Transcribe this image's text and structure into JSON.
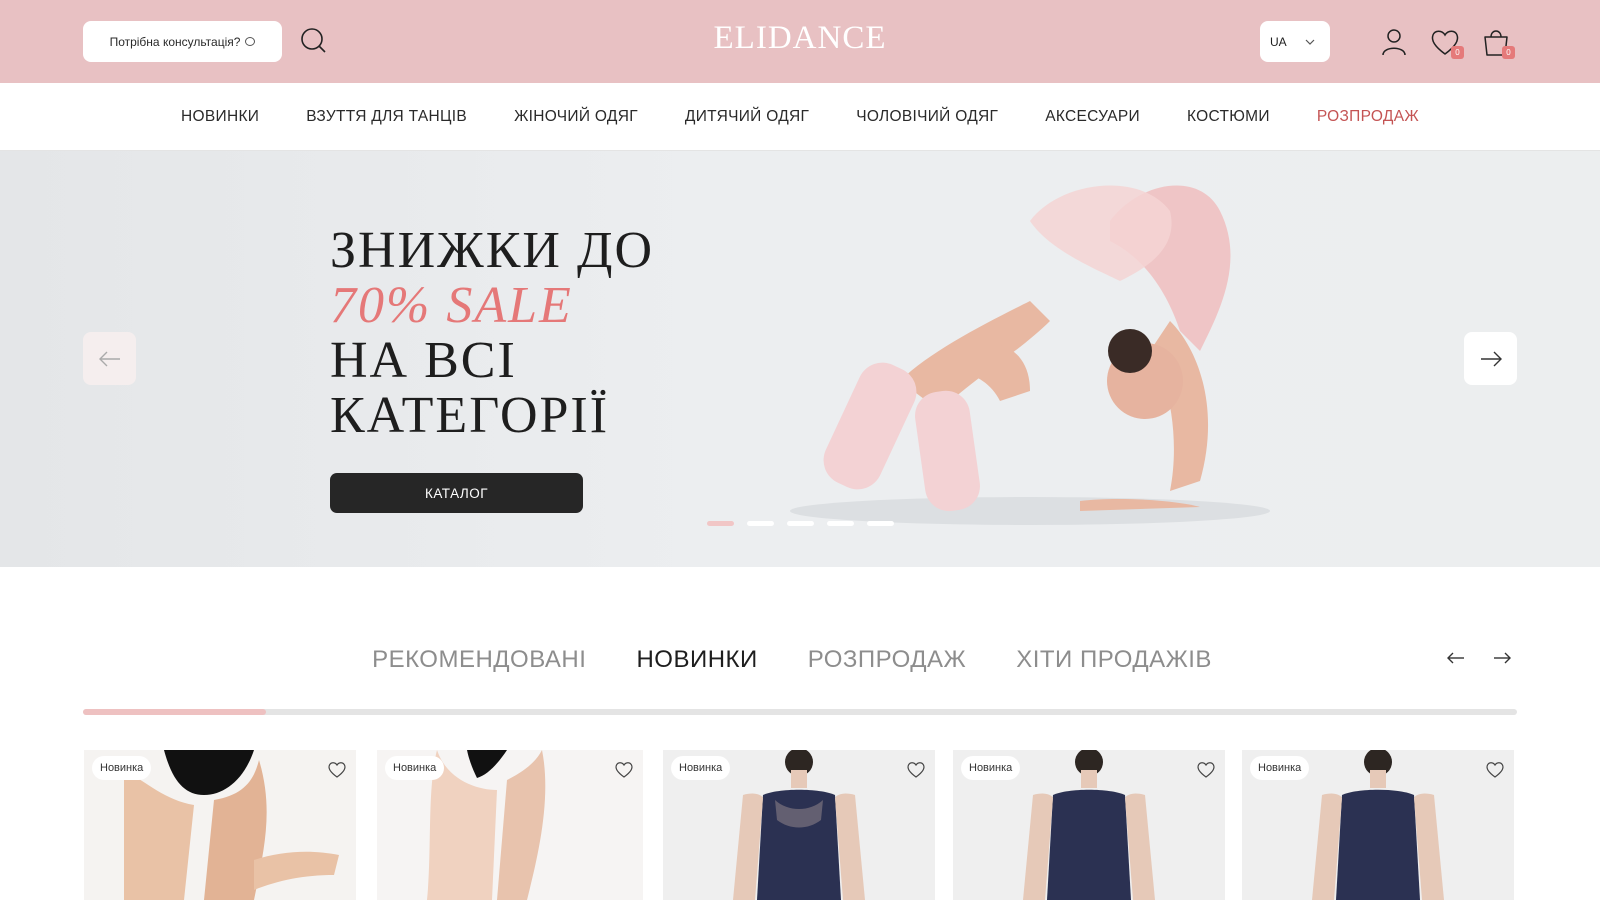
{
  "header": {
    "consult_label": "Потрібна консультація?",
    "logo": "ELIDANCE",
    "lang": "UA",
    "wishlist_count": "0",
    "cart_count": "0"
  },
  "nav": {
    "items": [
      "НОВИНКИ",
      "ВЗУТТЯ ДЛЯ ТАНЦІВ",
      "ЖІНОЧИЙ ОДЯГ",
      "ДИТЯЧИЙ ОДЯГ",
      "ЧОЛОВІЧИЙ ОДЯГ",
      "АКСЕСУАРИ",
      "КОСТЮМИ",
      "РОЗПРОДАЖ"
    ]
  },
  "hero": {
    "line1": "ЗНИЖКИ ДО",
    "line2": "70% SALE",
    "line3": "НА ВСІ",
    "line4": "КАТЕГОРІЇ",
    "button": "КАТАЛОГ",
    "slide_count": 5,
    "active_slide": 1
  },
  "tabs": {
    "items": [
      "РЕКОМЕНДОВАНІ",
      "НОВИНКИ",
      "РОЗПРОДАЖ",
      "ХІТИ ПРОДАЖІВ"
    ],
    "active": "НОВИНКИ"
  },
  "products": [
    {
      "tag": "Новинка"
    },
    {
      "tag": "Новинка"
    },
    {
      "tag": "Новинка"
    },
    {
      "tag": "Новинка"
    },
    {
      "tag": "Новинка"
    }
  ],
  "colors": {
    "header_bg": "#e8c1c3",
    "accent": "#e57878",
    "sale_nav": "#c45454",
    "button_dark": "#262626"
  }
}
